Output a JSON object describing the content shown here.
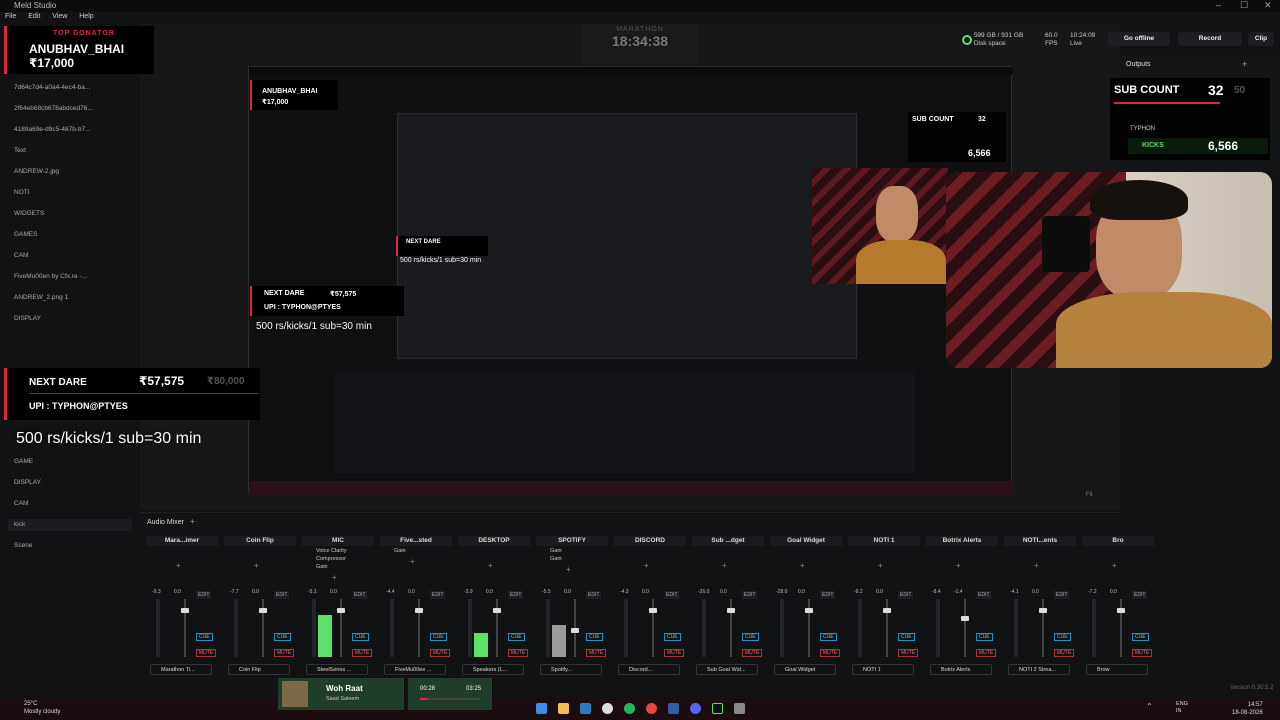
{
  "window": {
    "title": "Meld Studio",
    "minimize": "–",
    "maximize": "☐",
    "close": "✕"
  },
  "menu": [
    "File",
    "Edit",
    "View",
    "Help"
  ],
  "timer": {
    "label": "MARATHON",
    "time": "18:34:38"
  },
  "donator": {
    "label": "TOP DONATOR",
    "name": "ANUBHAV_BHAI",
    "amount": "₹17,000"
  },
  "dare": {
    "label": "NEXT DARE",
    "amount": "₹57,575",
    "goal": "₹80,000",
    "upi": "UPI : TYPHON@PTYES",
    "rule": "500 rs/kicks/1 sub=30 min"
  },
  "stats": {
    "disk": "599 GB / 931 GB",
    "disk_label": "Disk space",
    "fps": "60.0",
    "fps_label": "FPS",
    "live_time": "10:24:09",
    "live_label": "Live"
  },
  "buttons": {
    "offline": "Go offline",
    "record": "Record",
    "clip": "Clip"
  },
  "outputs": {
    "label": "Outputs",
    "add": "+"
  },
  "sub_count": {
    "label": "SUB COUNT",
    "value": "32",
    "goal": "50",
    "kicks_label": "KICKS",
    "kicks_value": "6,566",
    "channel": "TYPHON"
  },
  "sidebar": {
    "items": [
      {
        "label": "7d64c7d4-a0a4-4ec4-ba..."
      },
      {
        "label": "2f64eb68cb678abdced76..."
      },
      {
        "label": "4189a69e-d9c5-487b-b7..."
      },
      {
        "label": "Text"
      },
      {
        "label": "ANDREW-2.jpg"
      },
      {
        "label": "NOTI"
      },
      {
        "label": "WIDGETS"
      },
      {
        "label": "GAMES"
      },
      {
        "label": "CAM"
      },
      {
        "label": "FiveMu00en by Cfx.re -..."
      },
      {
        "label": "ANDREW_2.png 1"
      },
      {
        "label": "DISPLAY"
      }
    ],
    "scenes": [
      {
        "label": "GAME"
      },
      {
        "label": "DISPLAY"
      },
      {
        "label": "CAM"
      },
      {
        "label": "kick"
      },
      {
        "label": "Scene"
      }
    ]
  },
  "preview": {
    "fit": "Fit"
  },
  "mixer": {
    "title": "Audio Mixer",
    "add": "+",
    "edit": "EDIT",
    "cue": "CUE",
    "mute": "MUTE",
    "channels": [
      {
        "name": "Mara...imer",
        "level": "-9.3",
        "gain": "0.0",
        "source": "Marathon Ti...",
        "fill": 0.0,
        "knob": 0.15
      },
      {
        "name": "Coin Flip",
        "level": "-7.7",
        "gain": "0.0",
        "source": "Coin Flip",
        "fill": 0.0,
        "knob": 0.15
      },
      {
        "name": "MIC",
        "level": "-5.1",
        "gain": "0.0",
        "source": "SteelSeries ...",
        "fill": 0.72,
        "knob": 0.15,
        "fx": [
          "Voice Clarity",
          "Compressor",
          "Gain"
        ]
      },
      {
        "name": "Five...sted",
        "level": "-4.4",
        "gain": "0.0",
        "source": "FiveMu00ee ...",
        "fill": 0.0,
        "knob": 0.15,
        "fx": [
          "Gain"
        ]
      },
      {
        "name": "DESKTOP",
        "level": "-3.9",
        "gain": "0.0",
        "source": "Speakers (L...",
        "fill": 0.42,
        "knob": 0.15
      },
      {
        "name": "SPOTIFY",
        "level": "-5.5",
        "gain": "0.0",
        "source": "Spotify...",
        "fill": 0.55,
        "knob": 0.5,
        "fx": [
          "Gain",
          "Gain"
        ]
      },
      {
        "name": "DISCORD",
        "level": "-4.2",
        "gain": "0.0",
        "source": "Discord...",
        "fill": 0.0,
        "knob": 0.15
      },
      {
        "name": "Sub ...dget",
        "level": "-26.0",
        "gain": "0.0",
        "source": "Sub Goal Wid...",
        "fill": 0.0,
        "knob": 0.15
      },
      {
        "name": "Goal Widget",
        "level": "-28.0",
        "gain": "0.0",
        "source": "Goal Widget",
        "fill": 0.0,
        "knob": 0.15
      },
      {
        "name": "NOTI 1",
        "level": "-9.2",
        "gain": "0.0",
        "source": "NOTI 1",
        "fill": 0.0,
        "knob": 0.15
      },
      {
        "name": "Botrix Alerts",
        "level": "-8.4",
        "gain": "-1.4",
        "source": "Botrix Alerts",
        "fill": 0.0,
        "knob": 0.3
      },
      {
        "name": "NOTI...ents",
        "level": "-4.1",
        "gain": "0.0",
        "source": "NOTI 2 Strea...",
        "fill": 0.0,
        "knob": 0.15
      },
      {
        "name": "Bro",
        "level": "-7.2",
        "gain": "0.0",
        "source": "Brow",
        "fill": 0.0,
        "knob": 0.15
      }
    ]
  },
  "version": "Version 0.30.5.2",
  "weather": {
    "temp": "25°C",
    "desc": "Mostly cloudy"
  },
  "media": {
    "title": "Woh Raat",
    "artist": "Saad Saleem",
    "current": "00:28",
    "total": "03:25"
  },
  "tray": {
    "lang": "ENG",
    "region": "IN",
    "time": "14:57",
    "date": "18-08-2026"
  },
  "colors": {
    "accent_red": "#e0283c",
    "accent_green": "#5be06a",
    "cue_blue": "#2d8fc0",
    "taskbar": "#1b0c10"
  }
}
